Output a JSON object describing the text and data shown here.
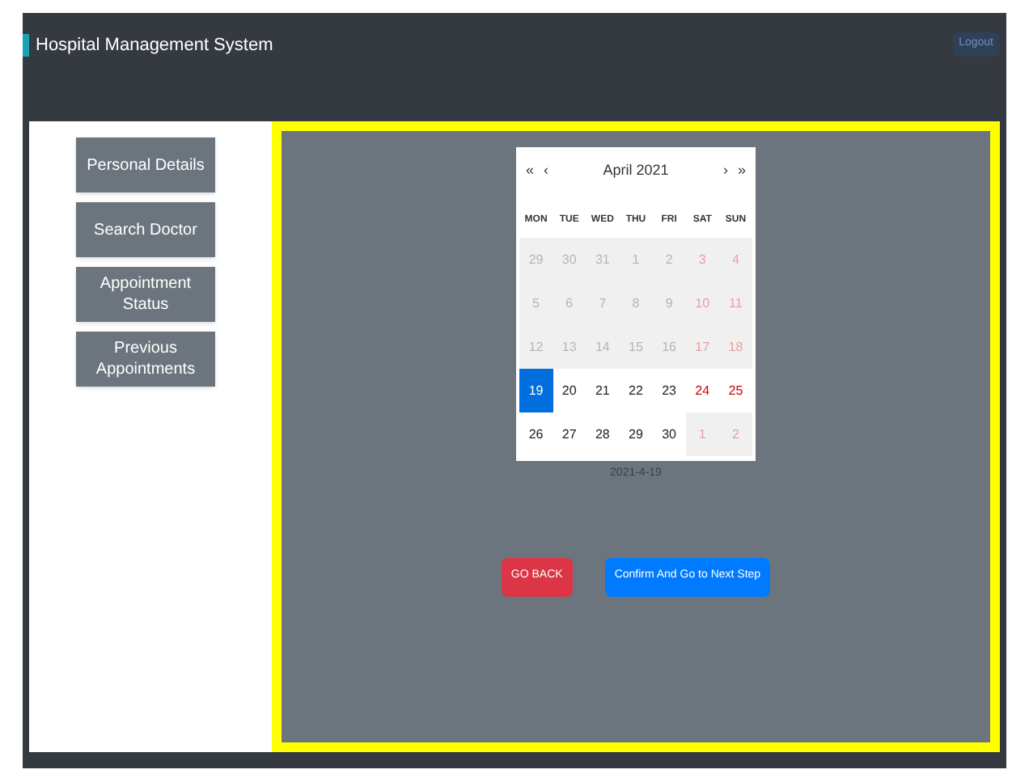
{
  "header": {
    "title": "Hospital Management System",
    "button": "Logout"
  },
  "sidebar": {
    "items": [
      "Personal Details",
      "Search Doctor",
      "Appointment Status",
      "Previous Appointments"
    ]
  },
  "calendar": {
    "nav": [
      "«",
      "‹",
      "›",
      "»"
    ],
    "month": "April 2021",
    "weekdays": [
      "MON",
      "TUE",
      "WED",
      "THU",
      "FRI",
      "SAT",
      "SUN"
    ],
    "days": [
      {
        "label": "29",
        "muted": true,
        "weekend": false,
        "selected": false
      },
      {
        "label": "30",
        "muted": true,
        "weekend": false,
        "selected": false
      },
      {
        "label": "31",
        "muted": true,
        "weekend": false,
        "selected": false
      },
      {
        "label": "1",
        "muted": true,
        "weekend": false,
        "selected": false
      },
      {
        "label": "2",
        "muted": true,
        "weekend": false,
        "selected": false
      },
      {
        "label": "3",
        "muted": true,
        "weekend": true,
        "selected": false
      },
      {
        "label": "4",
        "muted": true,
        "weekend": true,
        "selected": false
      },
      {
        "label": "5",
        "muted": true,
        "weekend": false,
        "selected": false
      },
      {
        "label": "6",
        "muted": true,
        "weekend": false,
        "selected": false
      },
      {
        "label": "7",
        "muted": true,
        "weekend": false,
        "selected": false
      },
      {
        "label": "8",
        "muted": true,
        "weekend": false,
        "selected": false
      },
      {
        "label": "9",
        "muted": true,
        "weekend": false,
        "selected": false
      },
      {
        "label": "10",
        "muted": true,
        "weekend": true,
        "selected": false
      },
      {
        "label": "11",
        "muted": true,
        "weekend": true,
        "selected": false
      },
      {
        "label": "12",
        "muted": true,
        "weekend": false,
        "selected": false
      },
      {
        "label": "13",
        "muted": true,
        "weekend": false,
        "selected": false
      },
      {
        "label": "14",
        "muted": true,
        "weekend": false,
        "selected": false
      },
      {
        "label": "15",
        "muted": true,
        "weekend": false,
        "selected": false
      },
      {
        "label": "16",
        "muted": true,
        "weekend": false,
        "selected": false
      },
      {
        "label": "17",
        "muted": true,
        "weekend": true,
        "selected": false
      },
      {
        "label": "18",
        "muted": true,
        "weekend": true,
        "selected": false
      },
      {
        "label": "19",
        "muted": false,
        "weekend": false,
        "selected": true
      },
      {
        "label": "20",
        "muted": false,
        "weekend": false,
        "selected": false
      },
      {
        "label": "21",
        "muted": false,
        "weekend": false,
        "selected": false
      },
      {
        "label": "22",
        "muted": false,
        "weekend": false,
        "selected": false
      },
      {
        "label": "23",
        "muted": false,
        "weekend": false,
        "selected": false
      },
      {
        "label": "24",
        "muted": false,
        "weekend": true,
        "selected": false
      },
      {
        "label": "25",
        "muted": false,
        "weekend": true,
        "selected": false
      },
      {
        "label": "26",
        "muted": false,
        "weekend": false,
        "selected": false
      },
      {
        "label": "27",
        "muted": false,
        "weekend": false,
        "selected": false
      },
      {
        "label": "28",
        "muted": false,
        "weekend": false,
        "selected": false
      },
      {
        "label": "29",
        "muted": false,
        "weekend": false,
        "selected": false
      },
      {
        "label": "30",
        "muted": false,
        "weekend": false,
        "selected": false
      },
      {
        "label": "1",
        "muted": true,
        "weekend": true,
        "selected": false
      },
      {
        "label": "2",
        "muted": true,
        "weekend": true,
        "selected": false
      }
    ]
  },
  "selected_date": "2021-4-19",
  "buttons": [
    {
      "label": "GO BACK",
      "kind": "danger"
    },
    {
      "label": "Confirm And Go to Next Step",
      "kind": "primary"
    }
  ]
}
